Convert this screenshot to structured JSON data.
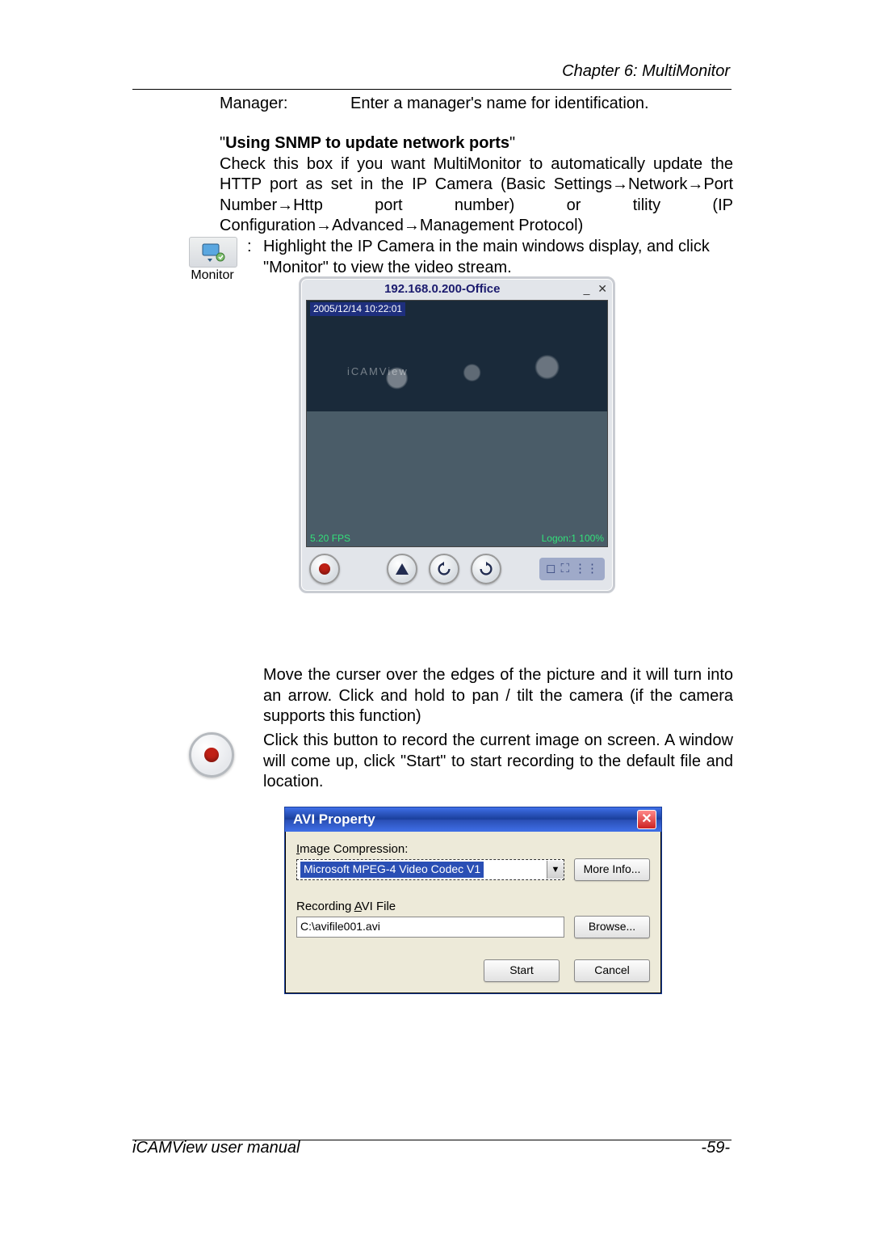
{
  "chapter_header": "Chapter 6: MultiMonitor",
  "footer_left": "iCAMView  user  manual",
  "footer_right": "-59-",
  "manager_label": "Manager:",
  "manager_desc": "Enter a manager's name for identification.",
  "snmp_quote_open": "\"",
  "snmp_title_bold": "Using SNMP to update network ports",
  "snmp_quote_close": "\"",
  "snmp_para": "Check this box if you want MultiMonitor to automatically update the HTTP port as set in the IP Camera (Basic Settings→Network→Port Number→Http port number) or tility (IP Configuration→Advanced→Management Protocol)",
  "monitor_caption": "Monitor",
  "monitor_para": "Highlight the IP Camera in the main windows display, and click \"Monitor\" to view the video stream.",
  "viewer": {
    "title": "192.168.0.200-Office",
    "timestamp": "2005/12/14 10:22:01",
    "fps": "5.20 FPS",
    "logon": "Logon:1 100%",
    "watermark": "iCAMView"
  },
  "pan_para": "Move the curser over the edges of the picture and it will turn into an arrow.  Click and hold to pan / tilt the camera (if the camera supports this function)",
  "rec_para": "Click this button to record the current image on screen. A window will come up, click \"Start\" to start recording to the default file and location.",
  "dialog": {
    "title": "AVI Property",
    "img_comp_label": "Image Compression:",
    "img_comp_value": "Microsoft MPEG-4 Video Codec V1",
    "more_info": "More Info...",
    "avi_file_label": "Recording AVI File",
    "avi_file_value": "C:\\avifile001.avi",
    "browse": "Browse...",
    "start": "Start",
    "cancel": "Cancel"
  }
}
